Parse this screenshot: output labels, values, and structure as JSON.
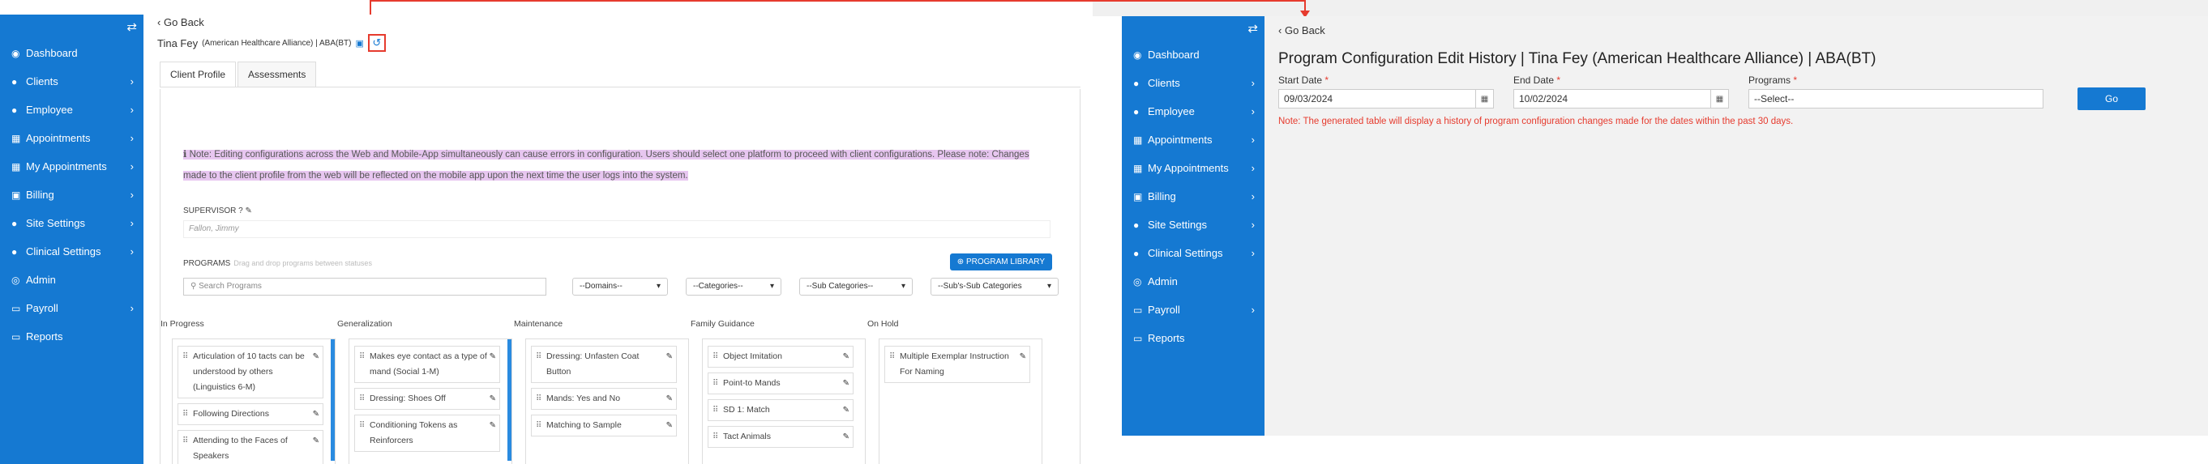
{
  "left": {
    "sidebar": {
      "items": [
        {
          "label": "Dashboard",
          "icon": "dashboard-icon",
          "glyph": "◉",
          "chevron": false
        },
        {
          "label": "Clients",
          "icon": "user-icon",
          "glyph": "●",
          "chevron": true
        },
        {
          "label": "Employee",
          "icon": "users-icon",
          "glyph": "●",
          "chevron": true
        },
        {
          "label": "Appointments",
          "icon": "calendar-icon",
          "glyph": "▦",
          "chevron": true
        },
        {
          "label": "My Appointments",
          "icon": "calendar-icon",
          "glyph": "▦",
          "chevron": true
        },
        {
          "label": "Billing",
          "icon": "money-icon",
          "glyph": "▣",
          "chevron": true
        },
        {
          "label": "Site Settings",
          "icon": "user-icon",
          "glyph": "●",
          "chevron": true
        },
        {
          "label": "Clinical Settings",
          "icon": "user-icon",
          "glyph": "●",
          "chevron": true
        },
        {
          "label": "Admin",
          "icon": "user-circle-icon",
          "glyph": "◎",
          "chevron": false
        },
        {
          "label": "Payroll",
          "icon": "card-icon",
          "glyph": "▭",
          "chevron": true
        },
        {
          "label": "Reports",
          "icon": "card-icon",
          "glyph": "▭",
          "chevron": false
        }
      ]
    },
    "go_back": "Go Back",
    "client": {
      "name": "Tina Fey",
      "detail": "(American Healthcare Alliance) | ABA(BT)"
    },
    "tabs": [
      "Client Profile",
      "Assessments"
    ],
    "note": "Note: Editing configurations across the Web and Mobile-App simultaneously can cause errors in configuration. Users should select one platform to proceed with client configurations. Please note: Changes made to the client profile from the web will be reflected on the mobile app upon the next time the user logs into the system.",
    "supervisor_label": "SUPERVISOR",
    "supervisor_value": "Fallon, Jimmy",
    "programs_label": "PROGRAMS",
    "programs_hint": "Drag and drop programs between statuses",
    "library_button": "PROGRAM LIBRARY",
    "search_placeholder": "Search Programs",
    "selects": [
      "--Domains--",
      "--Categories--",
      "--Sub Categories--",
      "--Sub's-Sub Categories"
    ],
    "columns": [
      {
        "title": "In Progress",
        "cards": [
          "Articulation of 10 tacts can be understood by others (Linguistics 6-M)",
          "Following Directions",
          "Attending to the Faces of Speakers"
        ]
      },
      {
        "title": "Generalization",
        "cards": [
          "Makes eye contact as a type of mand (Social 1-M)",
          "Dressing: Shoes Off",
          "Conditioning Tokens as Reinforcers"
        ]
      },
      {
        "title": "Maintenance",
        "cards": [
          "Dressing: Unfasten Coat Button",
          "Mands: Yes and No",
          "Matching to Sample"
        ]
      },
      {
        "title": "Family Guidance",
        "cards": [
          "Object Imitation",
          "Point-to Mands",
          "SD 1: Match",
          "Tact Animals"
        ]
      },
      {
        "title": "On Hold",
        "cards": [
          "Multiple Exemplar Instruction For Naming"
        ]
      }
    ]
  },
  "right": {
    "go_back": "Go Back",
    "title": "Program Configuration Edit History | Tina Fey (American Healthcare Alliance) | ABA(BT)",
    "start_date_label": "Start Date",
    "start_date_value": "09/03/2024",
    "end_date_label": "End Date",
    "end_date_value": "10/02/2024",
    "programs_label": "Programs",
    "programs_value": "--Select--",
    "go_button": "Go",
    "note": "Note: The generated table will display a history of program configuration changes made for the dates within the past 30 days."
  },
  "colors": {
    "sidebar": "#1579d2",
    "highlight": "#e63b2e",
    "note_bg": "#e7c6f0"
  }
}
